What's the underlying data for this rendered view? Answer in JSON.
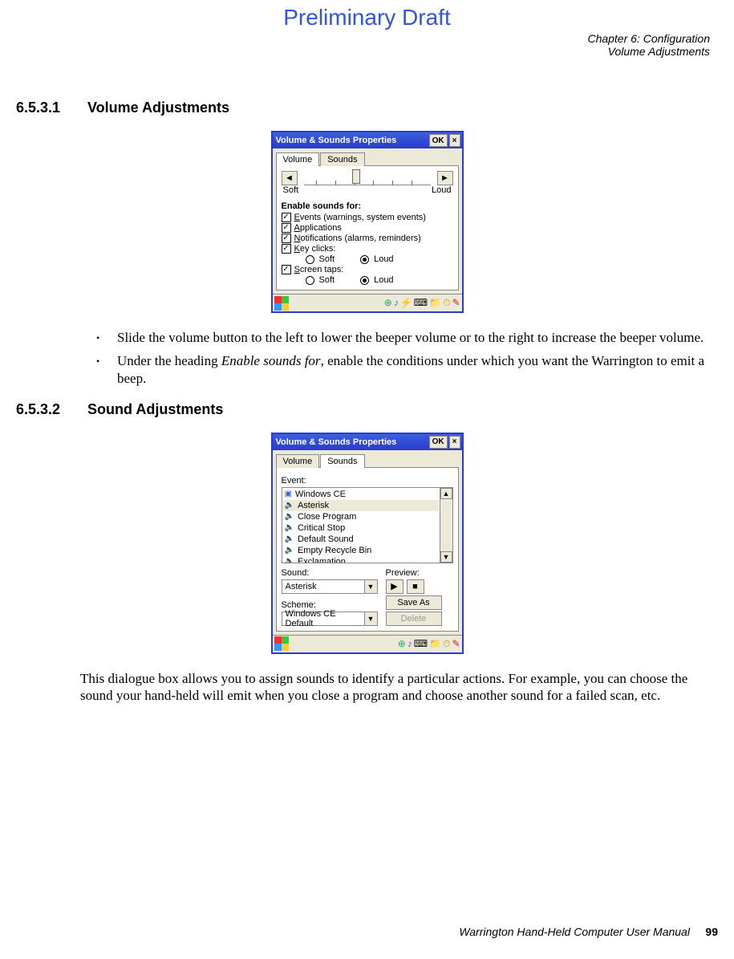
{
  "watermark": "Preliminary Draft",
  "header": {
    "chapter": "Chapter 6:  Configuration",
    "section": "Volume Adjustments"
  },
  "sec1": {
    "num": "6.5.3.1",
    "title": "Volume Adjustments"
  },
  "sec2": {
    "num": "6.5.3.2",
    "title": "Sound Adjustments"
  },
  "dlg1": {
    "title": "Volume & Sounds Properties",
    "ok": "OK",
    "close": "×",
    "tab_volume": "Volume",
    "tab_sounds": "Sounds",
    "soft": "Soft",
    "loud": "Loud",
    "enable_heading": "Enable sounds for:",
    "chk_events": "Events (warnings, system events)",
    "chk_apps": "Applications",
    "chk_notif": "Notifications (alarms, reminders)",
    "chk_keys": "Key clicks:",
    "chk_taps": "Screen taps:",
    "radio_soft": "Soft",
    "radio_loud": "Loud",
    "underlines": {
      "e": "E",
      "a": "A",
      "n": "N",
      "k": "K",
      "s": "S"
    }
  },
  "bullets": {
    "b1": "Slide the volume button to the left to lower the beeper volume or to the right to increase the beeper volume.",
    "b2a": "Under the heading ",
    "b2_i": "Enable sounds for",
    "b2b": ", enable the conditions under which you want the Warrington to emit a beep."
  },
  "dlg2": {
    "title": "Volume & Sounds Properties",
    "ok": "OK",
    "close": "×",
    "tab_volume": "Volume",
    "tab_sounds": "Sounds",
    "event_label": "Event:",
    "events": [
      "Windows CE",
      "Asterisk",
      "Close Program",
      "Critical Stop",
      "Default Sound",
      "Empty Recycle Bin",
      "Exclamation"
    ],
    "sound_label": "Sound:",
    "sound_value": "Asterisk",
    "preview_label": "Preview:",
    "scheme_label": "Scheme:",
    "scheme_value": "Windows CE Default",
    "save_as": "Save As",
    "delete": "Delete"
  },
  "para2": "This dialogue box allows you to assign sounds to identify a particular actions. For example, you can choose the sound your hand-held will emit when you close a program and choose another sound for a failed scan, etc.",
  "footer": {
    "manual": "Warrington Hand-Held Computer User Manual",
    "page": "99"
  }
}
